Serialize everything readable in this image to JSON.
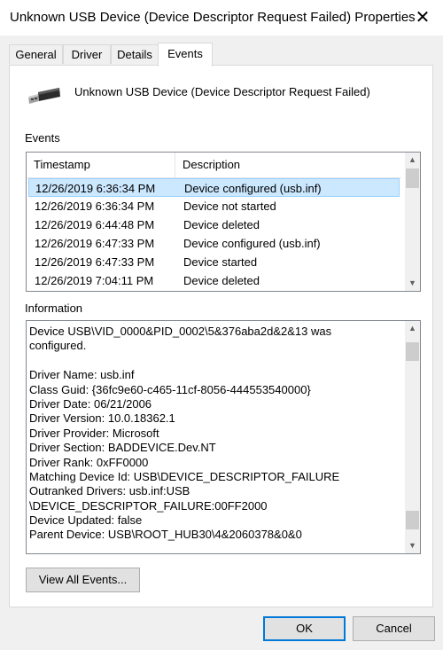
{
  "window": {
    "title": "Unknown USB Device (Device Descriptor Request Failed) Properties",
    "close_glyph": "✕"
  },
  "tabs": [
    {
      "label": "General",
      "active": false
    },
    {
      "label": "Driver",
      "active": false
    },
    {
      "label": "Details",
      "active": false
    },
    {
      "label": "Events",
      "active": true
    }
  ],
  "device": {
    "name": "Unknown USB Device (Device Descriptor Request Failed)",
    "icon": "usb-plug-icon"
  },
  "events": {
    "label": "Events",
    "columns": [
      "Timestamp",
      "Description"
    ],
    "rows": [
      {
        "timestamp": "12/26/2019 6:36:34 PM",
        "description": "Device configured (usb.inf)",
        "selected": true
      },
      {
        "timestamp": "12/26/2019 6:36:34 PM",
        "description": "Device not started",
        "selected": false
      },
      {
        "timestamp": "12/26/2019 6:44:48 PM",
        "description": "Device deleted",
        "selected": false
      },
      {
        "timestamp": "12/26/2019 6:47:33 PM",
        "description": "Device configured (usb.inf)",
        "selected": false
      },
      {
        "timestamp": "12/26/2019 6:47:33 PM",
        "description": "Device started",
        "selected": false
      },
      {
        "timestamp": "12/26/2019 7:04:11 PM",
        "description": "Device deleted",
        "selected": false
      }
    ]
  },
  "information": {
    "label": "Information",
    "lines": [
      "Device USB\\VID_0000&PID_0002\\5&376aba2d&2&13 was",
      "configured.",
      "",
      "Driver Name: usb.inf",
      "Class Guid: {36fc9e60-c465-11cf-8056-444553540000}",
      "Driver Date: 06/21/2006",
      "Driver Version: 10.0.18362.1",
      "Driver Provider: Microsoft",
      "Driver Section: BADDEVICE.Dev.NT",
      "Driver Rank: 0xFF0000",
      "Matching Device Id: USB\\DEVICE_DESCRIPTOR_FAILURE",
      "Outranked Drivers: usb.inf:USB",
      "\\DEVICE_DESCRIPTOR_FAILURE:00FF2000",
      "Device Updated: false",
      "Parent Device: USB\\ROOT_HUB30\\4&2060378&0&0"
    ]
  },
  "buttons": {
    "view_all": "View All Events...",
    "ok": "OK",
    "cancel": "Cancel"
  },
  "colors": {
    "selection": "#cce8ff",
    "selection_border": "#99d1ff",
    "default_button_border": "#0078d7"
  }
}
